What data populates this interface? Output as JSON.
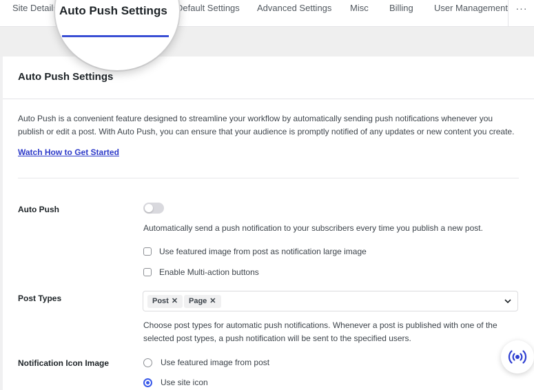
{
  "tabs": {
    "items": [
      "Site Details",
      "Auto Push Settings",
      "Default Settings",
      "Advanced Settings",
      "Misc",
      "Billing",
      "User Management"
    ],
    "more": "···",
    "active": "Auto Push Settings"
  },
  "card": {
    "title": "Auto Push Settings",
    "description": "Auto Push is a convenient feature designed to streamline your workflow by automatically sending push notifications whenever you publish or edit a post. With Auto Push, you can ensure that your audience is promptly notified of any updates or new content you create.",
    "watch_link": "Watch How to Get Started"
  },
  "auto_push": {
    "label": "Auto Push",
    "enabled": false,
    "help": "Automatically send a push notification to your subscribers every time you publish a new post.",
    "options": [
      {
        "label": "Use featured image from post as notification large image",
        "checked": false
      },
      {
        "label": "Enable Multi-action buttons",
        "checked": false
      }
    ]
  },
  "post_types": {
    "label": "Post Types",
    "selected": [
      "Post",
      "Page"
    ],
    "remove_glyph": "✕",
    "help": "Choose post types for automatic push notifications. Whenever a post is published with one of the selected post types, a push notification will be sent to the specified users."
  },
  "notification_icon": {
    "label": "Notification Icon Image",
    "options": [
      {
        "label": "Use featured image from post",
        "selected": false
      },
      {
        "label": "Use site icon",
        "selected": true
      }
    ]
  },
  "colors": {
    "accent": "#3858e9",
    "link": "#2d3ac9",
    "fab_icon": "#2f3fd1"
  },
  "icons": {
    "fab": "broadcast-icon",
    "dropdown": "chevron-down-icon"
  }
}
